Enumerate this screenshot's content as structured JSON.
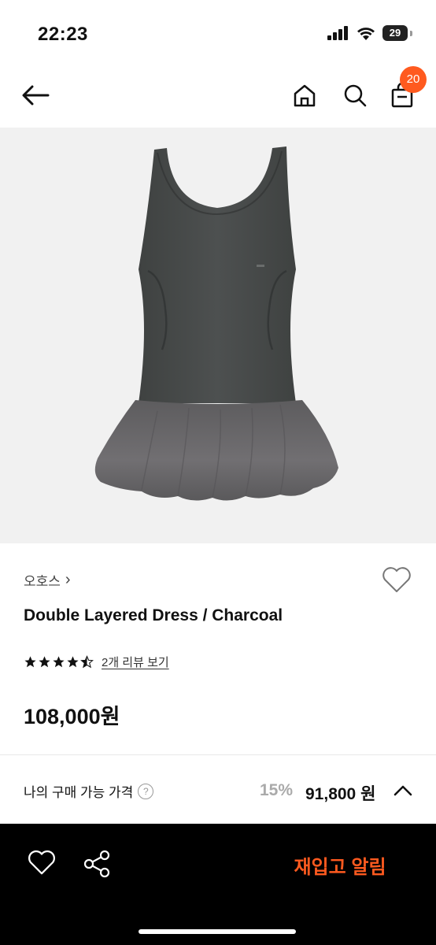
{
  "status_bar": {
    "time": "22:23",
    "battery": "29"
  },
  "nav": {
    "cart_count": "20"
  },
  "product": {
    "brand": "오호스",
    "brand_chevron": "›",
    "name": "Double Layered Dress / Charcoal",
    "rating": 4.5,
    "review_link": "2개 리뷰 보기",
    "price": "108,000원"
  },
  "my_price": {
    "label": "나의 구매 가능 가격",
    "help": "?",
    "discount": "15%",
    "price": "91,800 원"
  },
  "bottom_bar": {
    "restock_label": "재입고 알림"
  },
  "colors": {
    "accent": "#ff5a1f",
    "dress_top": "#4a4d4c",
    "dress_skirt": "#6b6a6c",
    "hero_bg": "#f1f1f1"
  },
  "icons": [
    "back-arrow-icon",
    "home-icon",
    "search-icon",
    "cart-icon",
    "heart-icon",
    "share-icon",
    "chevron-up-icon",
    "star-icon",
    "help-icon"
  ]
}
